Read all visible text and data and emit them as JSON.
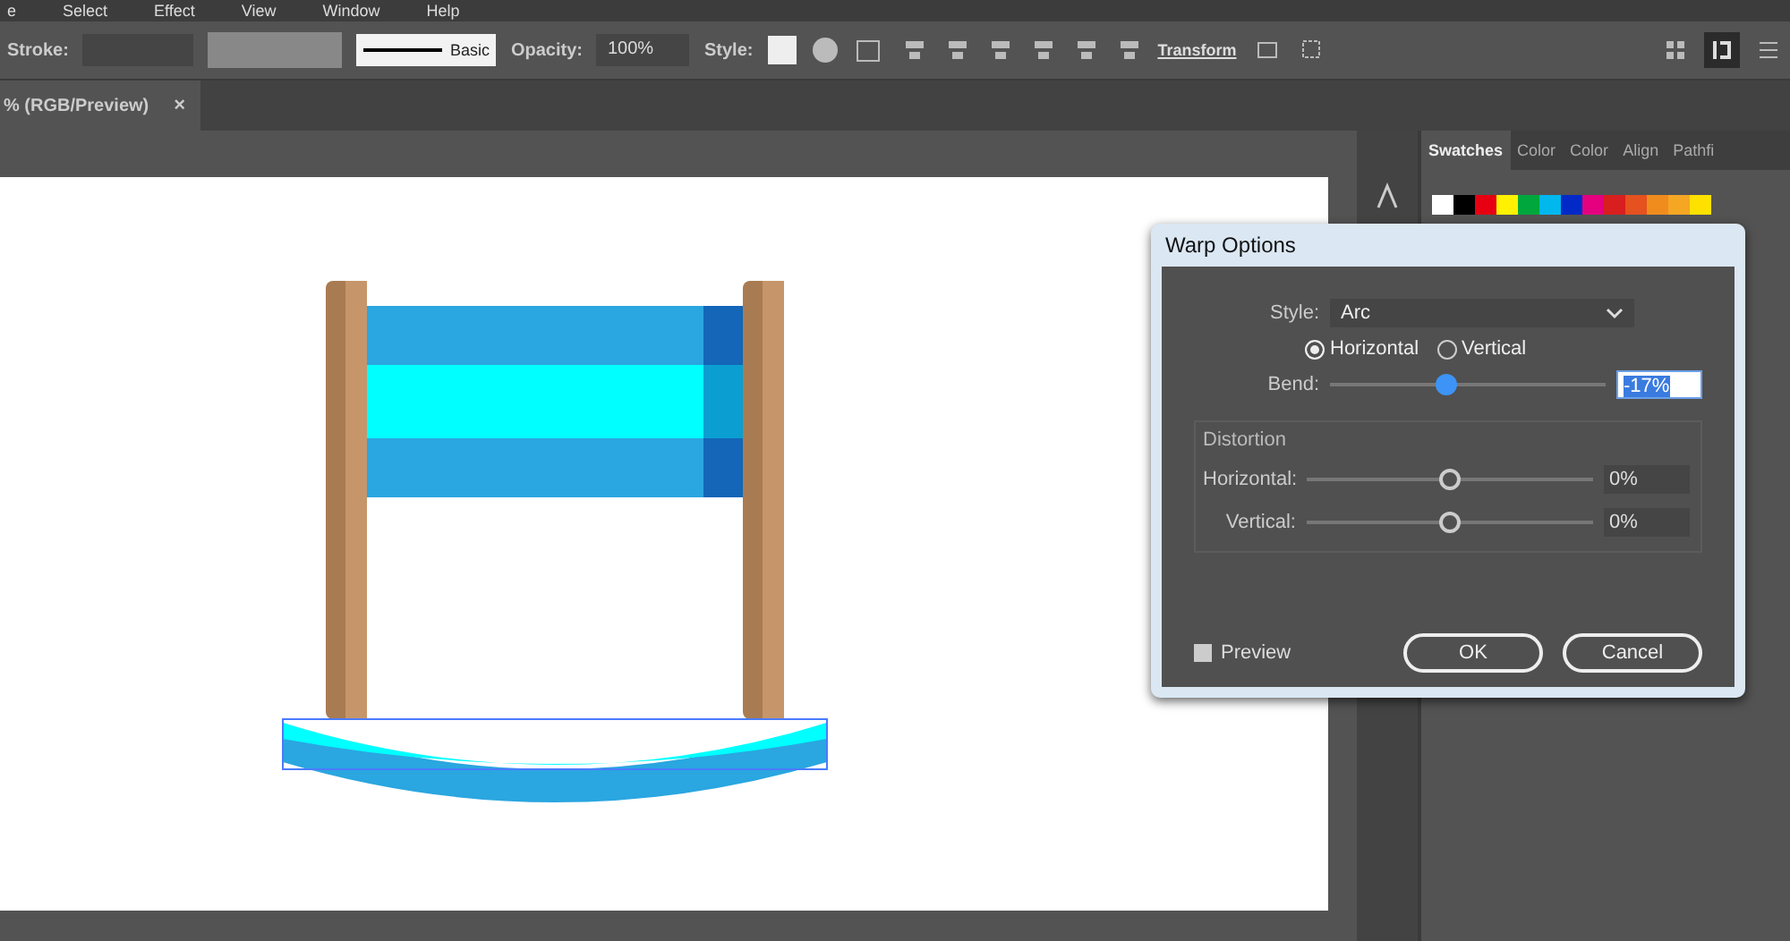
{
  "menu": [
    "e",
    "Select",
    "Effect",
    "View",
    "Window",
    "Help"
  ],
  "control_bar": {
    "stroke_label": "Stroke:",
    "brush_label": "Basic",
    "opacity_label": "Opacity:",
    "opacity_value": "100%",
    "style_label": "Style:",
    "transform_link": "Transform"
  },
  "document_tab": {
    "title": "% (RGB/Preview)",
    "close": "×"
  },
  "panel": {
    "tabs": [
      {
        "label": "Swatches",
        "selected": true
      },
      {
        "label": "Color",
        "selected": false
      },
      {
        "label": "Color",
        "selected": false
      },
      {
        "label": "Align",
        "selected": false
      },
      {
        "label": "Pathfi",
        "selected": false
      }
    ],
    "swatches": [
      {
        "color": "#ffffff"
      },
      {
        "color": "#000000"
      },
      {
        "color": "#e60012"
      },
      {
        "color": "#fff100"
      },
      {
        "color": "#00a73c"
      },
      {
        "color": "#00b7ee"
      },
      {
        "color": "#0029c8"
      },
      {
        "color": "#e4007f"
      },
      {
        "color": "#d81e1e"
      },
      {
        "color": "#e5511f"
      },
      {
        "color": "#f08c1e"
      },
      {
        "color": "#f5a623"
      },
      {
        "color": "#ffe100"
      }
    ]
  },
  "dialog": {
    "title": "Warp Options",
    "style_label": "Style:",
    "style_value": "Arc",
    "orientation": [
      {
        "label": "Horizontal",
        "selected": true
      },
      {
        "label": "Vertical",
        "selected": false
      }
    ],
    "bend": {
      "label": "Bend:",
      "level": 0.42,
      "value": "-17%"
    },
    "distortion_title": "Distortion",
    "distortion": [
      {
        "label": "Horizontal:",
        "level": 0.5,
        "value": "0%"
      },
      {
        "label": "Vertical:",
        "level": 0.5,
        "value": "0%"
      }
    ],
    "preview": {
      "label": "Preview",
      "checked": true
    },
    "buttons": [
      "OK",
      "Cancel"
    ]
  }
}
